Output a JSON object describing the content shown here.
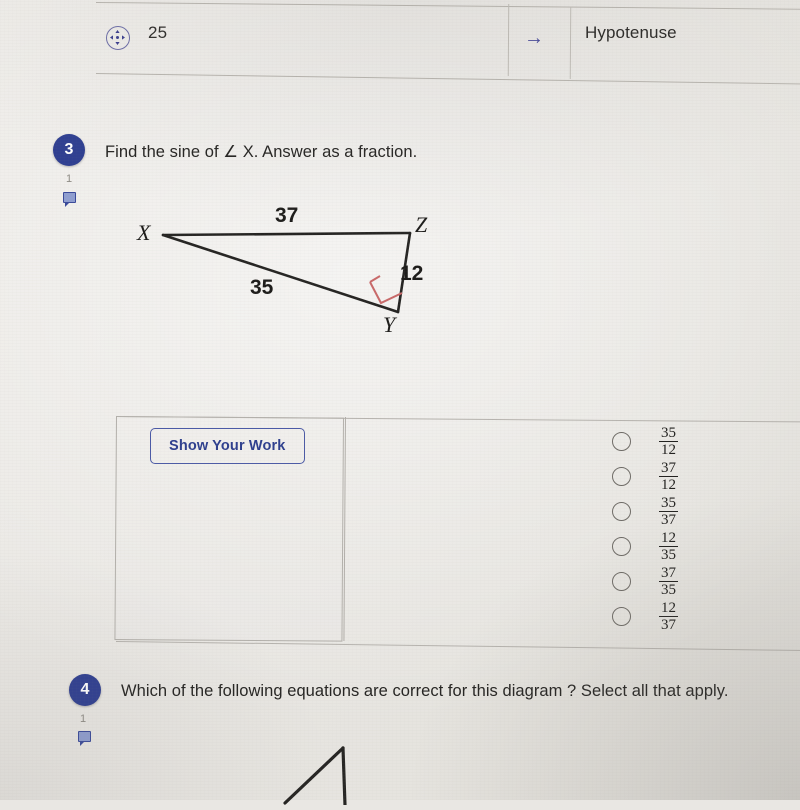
{
  "top_row": {
    "move_icon": "move-arrows-icon",
    "number": "25",
    "arrow_icon": "right-arrow-icon",
    "label": "Hypotenuse"
  },
  "question3": {
    "number": "3",
    "text": "Find the sine of ∠ X.  Answer as a fraction.",
    "comment_count": "1",
    "comment_icon": "comment-icon",
    "diagram": {
      "vertices": [
        "X",
        "Z",
        "Y"
      ],
      "side_labels": [
        "37",
        "35",
        "12"
      ],
      "right_angle_at": "Y",
      "right_angle_color": "#c96a6a"
    },
    "show_work_label": "Show Your Work",
    "choices": [
      {
        "num": "35",
        "den": "12"
      },
      {
        "num": "37",
        "den": "12"
      },
      {
        "num": "35",
        "den": "37"
      },
      {
        "num": "12",
        "den": "35"
      },
      {
        "num": "37",
        "den": "35"
      },
      {
        "num": "12",
        "den": "37"
      }
    ]
  },
  "question4": {
    "number": "4",
    "text": "Which of the following equations are correct for this diagram ?  Select all that apply.",
    "comment_count": "1",
    "comment_icon": "comment-icon"
  },
  "colors": {
    "badge_blue": "#2f3f91",
    "link_blue": "#2e3f8e",
    "page_bg": "#e9e7e3",
    "rule": "#b6b3ae",
    "right_angle_red": "#c96a6a"
  }
}
